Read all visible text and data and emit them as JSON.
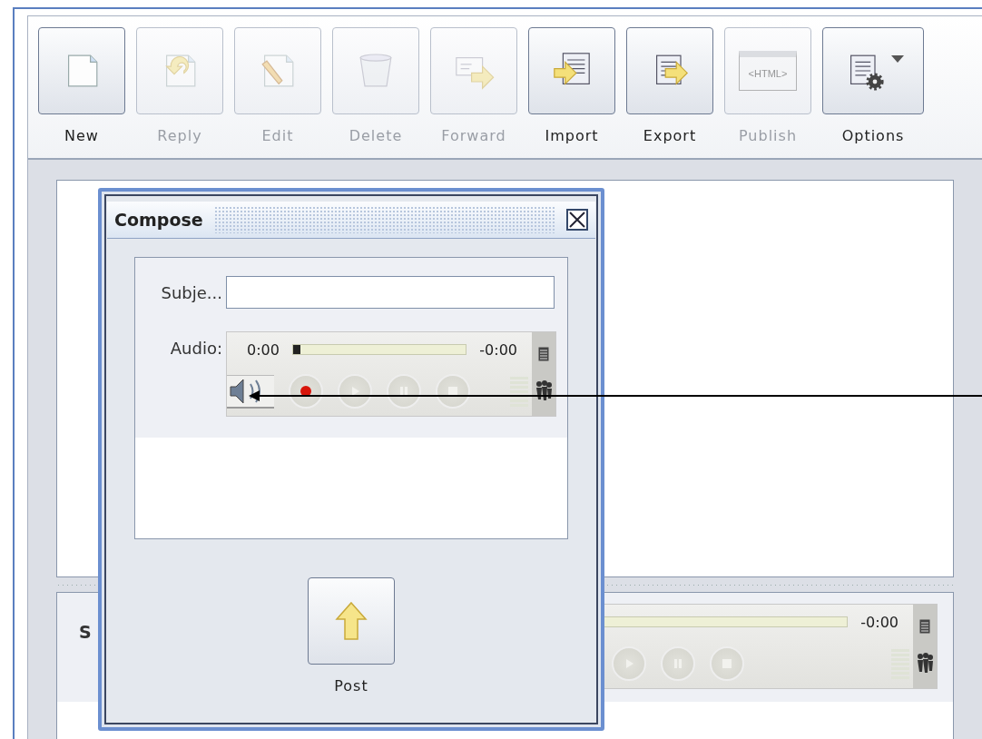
{
  "toolbar": {
    "buttons": [
      {
        "label": "New",
        "kind": "new",
        "disabled": false
      },
      {
        "label": "Reply",
        "kind": "reply",
        "disabled": true
      },
      {
        "label": "Edit",
        "kind": "edit",
        "disabled": true
      },
      {
        "label": "Delete",
        "kind": "delete",
        "disabled": true
      },
      {
        "label": "Forward",
        "kind": "forward",
        "disabled": true
      },
      {
        "label": "Import",
        "kind": "import",
        "disabled": false
      },
      {
        "label": "Export",
        "kind": "export",
        "disabled": false
      },
      {
        "label": "Publish",
        "kind": "publish",
        "disabled": true,
        "icon_text": "<HTML>"
      },
      {
        "label": "Options",
        "kind": "options",
        "disabled": false
      }
    ]
  },
  "lower_panel": {
    "label": "S",
    "player": {
      "end_time": "-0:00",
      "level": 0
    }
  },
  "compose": {
    "title": "Compose",
    "subject": {
      "label": "Subje..."
    },
    "audio": {
      "label": "Audio:",
      "player": {
        "start_time": "0:00",
        "end_time": "-0:00",
        "level": 0.04
      }
    },
    "post": {
      "label": "Post"
    }
  }
}
